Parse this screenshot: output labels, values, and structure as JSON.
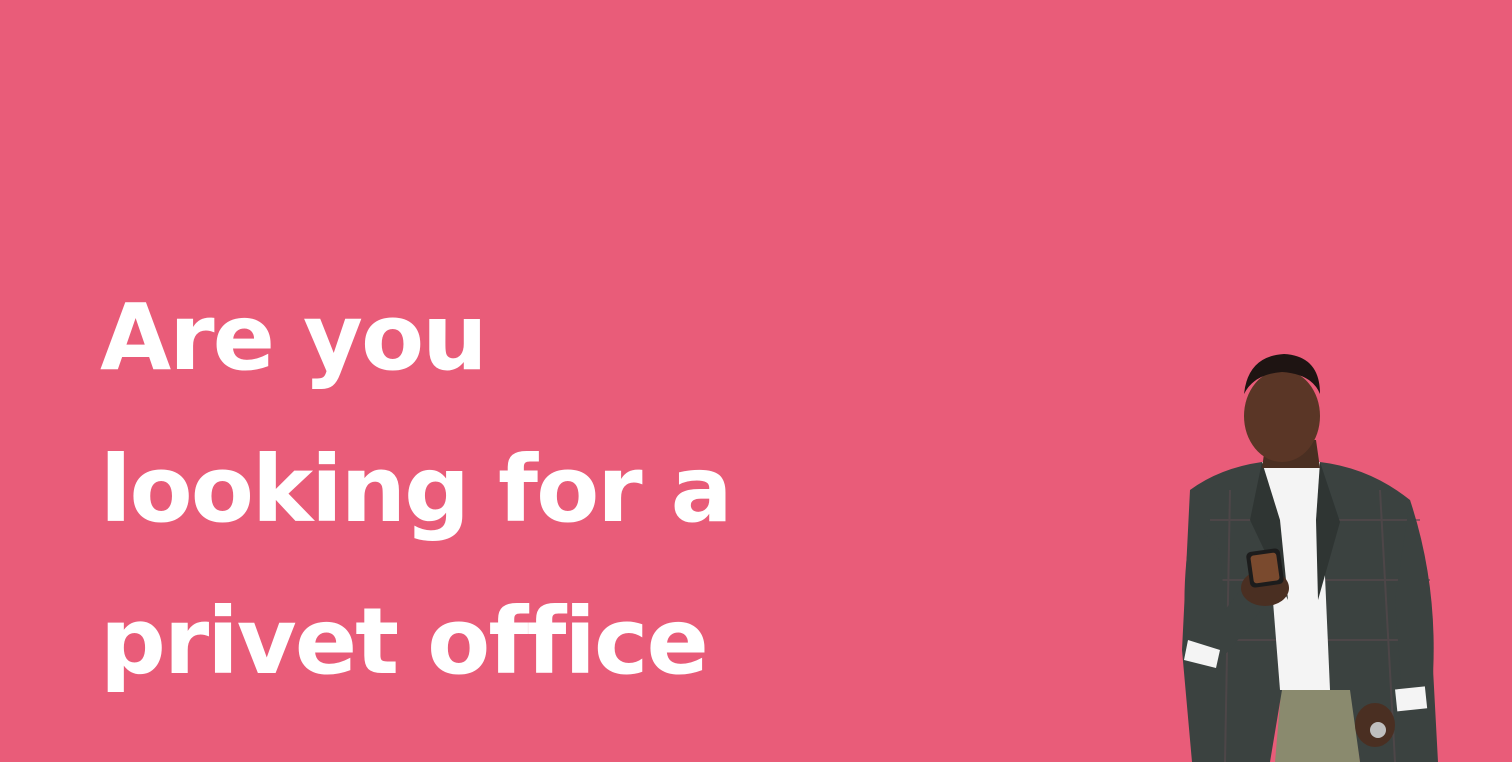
{
  "headline": {
    "line1": "Are you",
    "line2": "looking for a",
    "line3": "privet office"
  },
  "colors": {
    "background": "#e95c79",
    "text": "#ffffff"
  },
  "image": {
    "subject": "man-in-suit-looking-at-phone"
  }
}
